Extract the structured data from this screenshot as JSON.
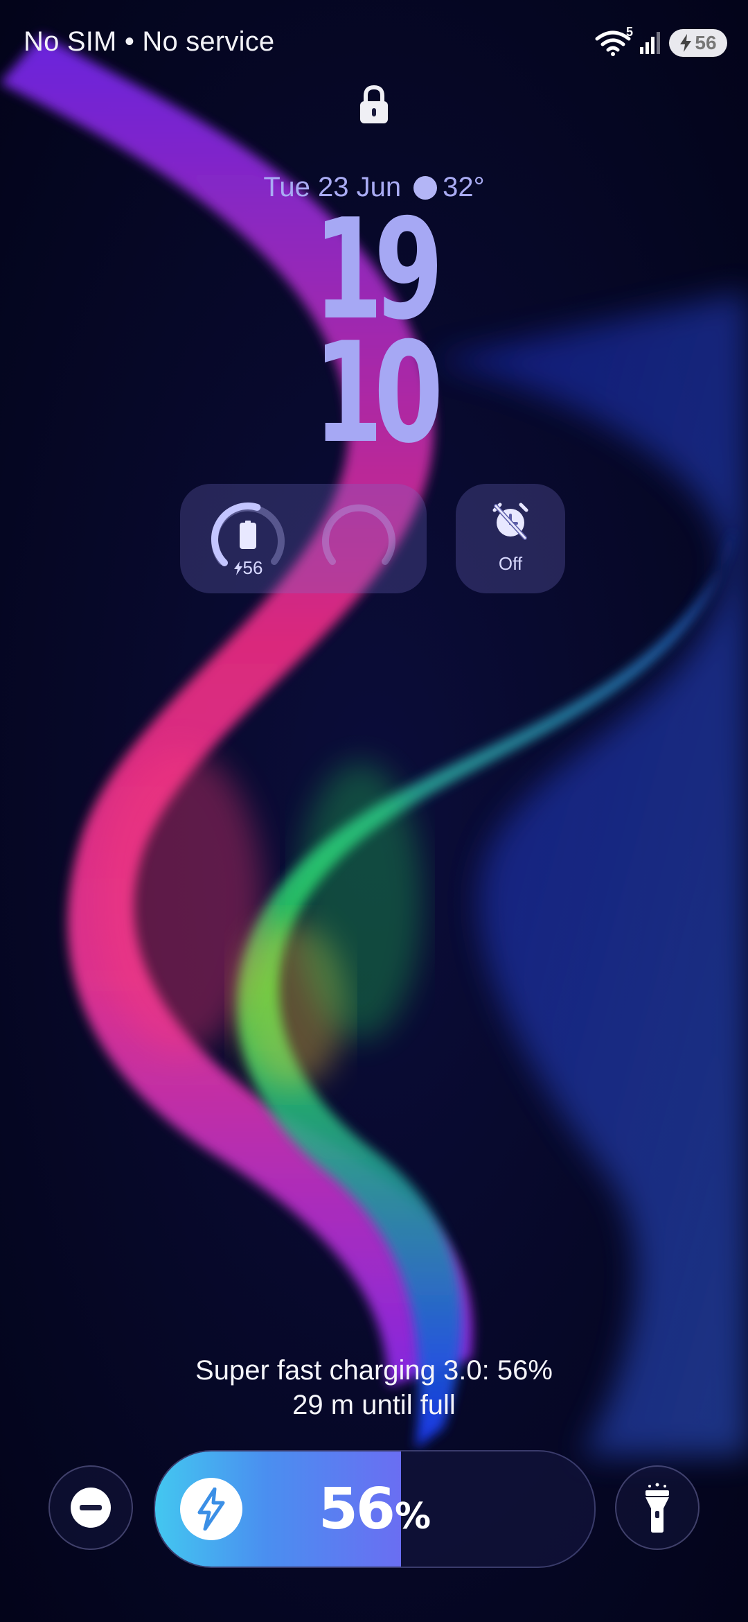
{
  "status_bar": {
    "carrier": "No SIM • No service",
    "wifi_badge": "5",
    "battery_level": "56"
  },
  "lock_screen": {
    "date": "Tue 23 Jun",
    "temperature": "32°",
    "clock_hour": "19",
    "clock_minute": "10"
  },
  "widgets": {
    "battery_gauge_label": "56",
    "battery_gauge_fraction": 0.56,
    "alarm_label": "Off"
  },
  "charging": {
    "line1": "Super fast charging 3.0: 56%",
    "line2": "29 m until full",
    "percent_value": "56",
    "percent_unit": "%",
    "fill_fraction": 0.56
  },
  "icons": {
    "lock": "lock-icon",
    "dnd": "do-not-disturb-icon",
    "flashlight": "flashlight-icon",
    "bolt": "lightning-bolt-icon",
    "alarm_off": "alarm-off-icon",
    "wifi": "wifi-icon",
    "signal": "cellular-signal-icon"
  },
  "colors": {
    "accent_lavender": "#a6a8f4",
    "charge_gradient_start": "#43c7f0",
    "charge_gradient_end": "#6a6ef2"
  }
}
